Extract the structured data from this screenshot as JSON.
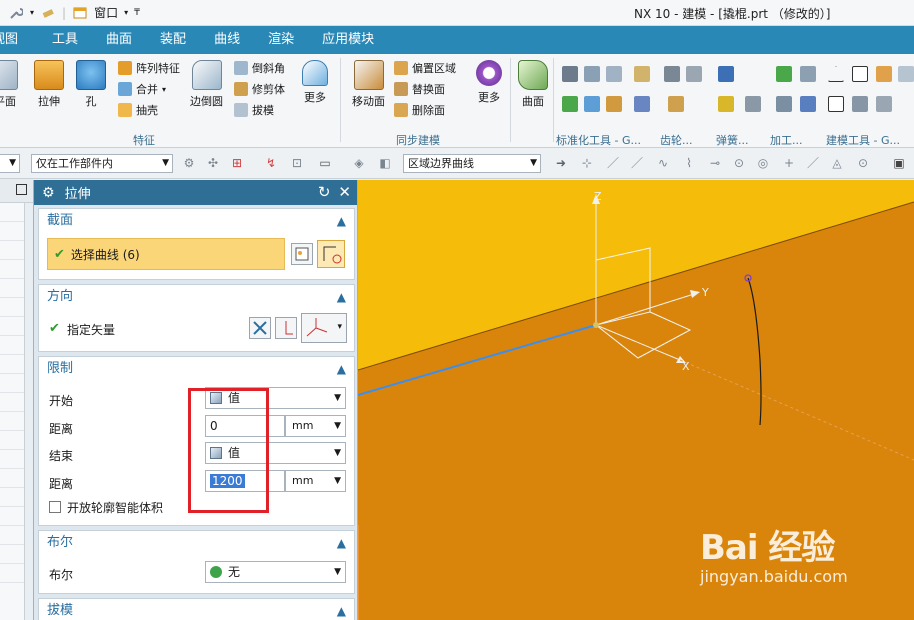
{
  "window": {
    "title": "NX 10 - 建模 - [撬棍.prt （修改的）]",
    "quick_access": {
      "window_menu": "窗口"
    }
  },
  "menu": [
    "视图",
    "工具",
    "曲面",
    "装配",
    "曲线",
    "渲染",
    "应用模块"
  ],
  "ribbon": {
    "feature_group": {
      "label": "特征",
      "plane_partial": "基准平面",
      "extrude": "拉伸",
      "hole": "孔",
      "pattern": "阵列特征",
      "unite": "合并",
      "shell": "抽壳",
      "edge_blend": "边倒圆",
      "chamfer": "倒斜角",
      "trim_body": "修剪体",
      "draft": "拔模",
      "more": "更多"
    },
    "sync_group": {
      "label": "同步建模",
      "move_face": "移动面",
      "offset_region": "偏置区域",
      "replace_face": "替换面",
      "delete_face": "删除面",
      "more": "更多"
    },
    "surface": {
      "label": "曲面"
    },
    "extra_groups": [
      "标准化工具 - G...",
      "齿轮...",
      "弹簧...",
      "加工...",
      "建模工具 - G..."
    ]
  },
  "selection_bar": {
    "scope": "仅在工作部件内",
    "curve_rule": "区域边界曲线"
  },
  "dialog": {
    "title": "拉伸",
    "section_label": "截面",
    "select_curve": "选择曲线 (6)",
    "direction_label": "方向",
    "specify_vector": "指定矢量",
    "limits_label": "限制",
    "start_label": "开始",
    "start_type": "值",
    "start_distance_label": "距离",
    "start_distance": "0",
    "start_unit": "mm",
    "end_label": "结束",
    "end_type": "值",
    "end_distance_label": "距离",
    "end_distance": "1200",
    "end_unit": "mm",
    "open_profile": "开放轮廓智能体积",
    "boolean_label": "布尔",
    "boolean_field_label": "布尔",
    "boolean_value": "无",
    "draft_label": "拔模"
  },
  "viewport": {
    "axis_z": "Z",
    "axis_y": "Y",
    "axis_x": "X",
    "colors": {
      "upper": "#f5bd0a",
      "lower": "#d9850c"
    }
  },
  "watermark": {
    "brand": "Bai 经验",
    "url": "jingyan.baidu.com"
  }
}
